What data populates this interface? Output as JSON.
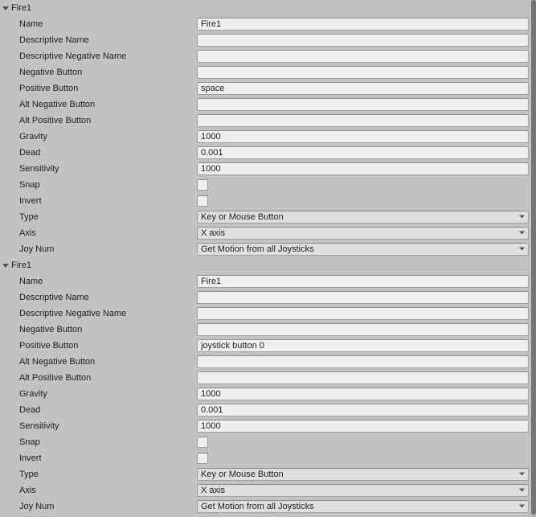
{
  "sections": [
    {
      "title": "Fire1",
      "fields": {
        "name_label": "Name",
        "name_value": "Fire1",
        "desc_name_label": "Descriptive Name",
        "desc_name_value": "",
        "desc_neg_name_label": "Descriptive Negative Name",
        "desc_neg_name_value": "",
        "neg_button_label": "Negative Button",
        "neg_button_value": "",
        "pos_button_label": "Positive Button",
        "pos_button_value": "space",
        "alt_neg_button_label": "Alt Negative Button",
        "alt_neg_button_value": "",
        "alt_pos_button_label": "Alt Positive Button",
        "alt_pos_button_value": "",
        "gravity_label": "Gravity",
        "gravity_value": "1000",
        "dead_label": "Dead",
        "dead_value": "0.001",
        "sensitivity_label": "Sensitivity",
        "sensitivity_value": "1000",
        "snap_label": "Snap",
        "snap_value": false,
        "invert_label": "Invert",
        "invert_value": false,
        "type_label": "Type",
        "type_value": "Key or Mouse Button",
        "axis_label": "Axis",
        "axis_value": "X axis",
        "joynum_label": "Joy Num",
        "joynum_value": "Get Motion from all Joysticks"
      }
    },
    {
      "title": "Fire1",
      "fields": {
        "name_label": "Name",
        "name_value": "Fire1",
        "desc_name_label": "Descriptive Name",
        "desc_name_value": "",
        "desc_neg_name_label": "Descriptive Negative Name",
        "desc_neg_name_value": "",
        "neg_button_label": "Negative Button",
        "neg_button_value": "",
        "pos_button_label": "Positive Button",
        "pos_button_value": "joystick button 0",
        "alt_neg_button_label": "Alt Negative Button",
        "alt_neg_button_value": "",
        "alt_pos_button_label": "Alt Positive Button",
        "alt_pos_button_value": "",
        "gravity_label": "Gravity",
        "gravity_value": "1000",
        "dead_label": "Dead",
        "dead_value": "0.001",
        "sensitivity_label": "Sensitivity",
        "sensitivity_value": "1000",
        "snap_label": "Snap",
        "snap_value": false,
        "invert_label": "Invert",
        "invert_value": false,
        "type_label": "Type",
        "type_value": "Key or Mouse Button",
        "axis_label": "Axis",
        "axis_value": "X axis",
        "joynum_label": "Joy Num",
        "joynum_value": "Get Motion from all Joysticks"
      }
    }
  ]
}
